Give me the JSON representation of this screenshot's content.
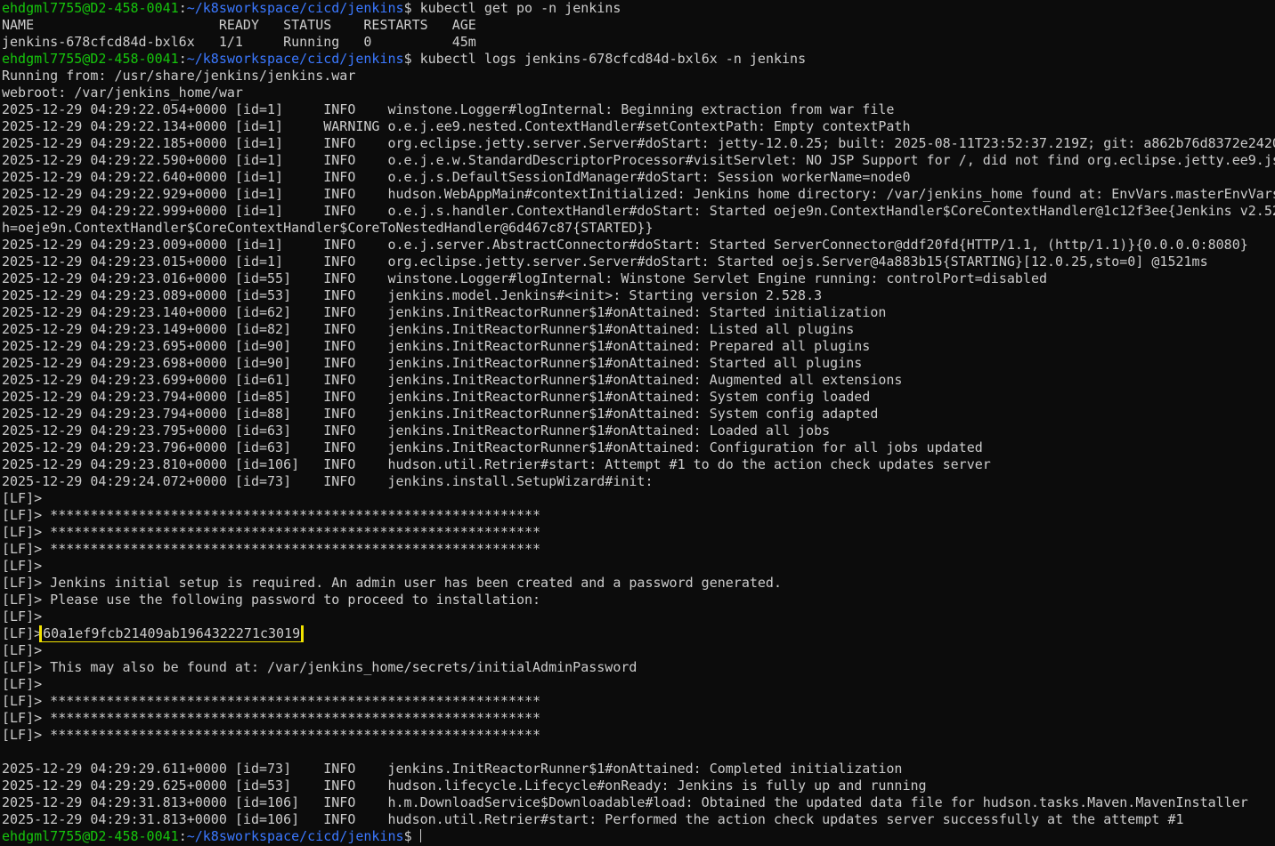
{
  "prompt": {
    "user_host": "ehdgml7755@D2-458-0041",
    "sep": ":",
    "path": "~/k8sworkspace/cicd/jenkins",
    "symbol": "$ "
  },
  "commands": {
    "get_pods": "kubectl get po -n jenkins",
    "logs": "kubectl logs jenkins-678cfcd84d-bxl6x -n jenkins"
  },
  "pods_table": {
    "header": "NAME                       READY   STATUS    RESTARTS   AGE",
    "row": "jenkins-678cfcd84d-bxl6x   1/1     Running   0          45m"
  },
  "log_lines": [
    "Running from: /usr/share/jenkins/jenkins.war",
    "webroot: /var/jenkins_home/war",
    "2025-12-29 04:29:22.054+0000 [id=1]     INFO    winstone.Logger#logInternal: Beginning extraction from war file",
    "2025-12-29 04:29:22.134+0000 [id=1]     WARNING o.e.j.ee9.nested.ContextHandler#setContextPath: Empty contextPath",
    "2025-12-29 04:29:22.185+0000 [id=1]     INFO    org.eclipse.jetty.server.Server#doStart: jetty-12.0.25; built: 2025-08-11T23:52:37.219Z; git: a862b76d8372e2420",
    "2025-12-29 04:29:22.590+0000 [id=1]     INFO    o.e.j.e.w.StandardDescriptorProcessor#visitServlet: NO JSP Support for /, did not find org.eclipse.jetty.ee9.js",
    "2025-12-29 04:29:22.640+0000 [id=1]     INFO    o.e.j.s.DefaultSessionIdManager#doStart: Session workerName=node0",
    "2025-12-29 04:29:22.929+0000 [id=1]     INFO    hudson.WebAppMain#contextInitialized: Jenkins home directory: /var/jenkins_home found at: EnvVars.masterEnvVars",
    "2025-12-29 04:29:22.999+0000 [id=1]     INFO    o.e.j.s.handler.ContextHandler#doStart: Started oeje9n.ContextHandler$CoreContextHandler@1c12f3ee{Jenkins v2.52",
    "h=oeje9n.ContextHandler$CoreContextHandler$CoreToNestedHandler@6d467c87{STARTED}}",
    "2025-12-29 04:29:23.009+0000 [id=1]     INFO    o.e.j.server.AbstractConnector#doStart: Started ServerConnector@ddf20fd{HTTP/1.1, (http/1.1)}{0.0.0.0:8080}",
    "2025-12-29 04:29:23.015+0000 [id=1]     INFO    org.eclipse.jetty.server.Server#doStart: Started oejs.Server@4a883b15{STARTING}[12.0.25,sto=0] @1521ms",
    "2025-12-29 04:29:23.016+0000 [id=55]    INFO    winstone.Logger#logInternal: Winstone Servlet Engine running: controlPort=disabled",
    "2025-12-29 04:29:23.089+0000 [id=53]    INFO    jenkins.model.Jenkins#<init>: Starting version 2.528.3",
    "2025-12-29 04:29:23.140+0000 [id=62]    INFO    jenkins.InitReactorRunner$1#onAttained: Started initialization",
    "2025-12-29 04:29:23.149+0000 [id=82]    INFO    jenkins.InitReactorRunner$1#onAttained: Listed all plugins",
    "2025-12-29 04:29:23.695+0000 [id=90]    INFO    jenkins.InitReactorRunner$1#onAttained: Prepared all plugins",
    "2025-12-29 04:29:23.698+0000 [id=90]    INFO    jenkins.InitReactorRunner$1#onAttained: Started all plugins",
    "2025-12-29 04:29:23.699+0000 [id=61]    INFO    jenkins.InitReactorRunner$1#onAttained: Augmented all extensions",
    "2025-12-29 04:29:23.794+0000 [id=85]    INFO    jenkins.InitReactorRunner$1#onAttained: System config loaded",
    "2025-12-29 04:29:23.794+0000 [id=88]    INFO    jenkins.InitReactorRunner$1#onAttained: System config adapted",
    "2025-12-29 04:29:23.795+0000 [id=63]    INFO    jenkins.InitReactorRunner$1#onAttained: Loaded all jobs",
    "2025-12-29 04:29:23.796+0000 [id=63]    INFO    jenkins.InitReactorRunner$1#onAttained: Configuration for all jobs updated",
    "2025-12-29 04:29:23.810+0000 [id=106]   INFO    hudson.util.Retrier#start: Attempt #1 to do the action check updates server",
    "2025-12-29 04:29:24.072+0000 [id=73]    INFO    jenkins.install.SetupWizard#init:",
    "[LF]>",
    "[LF]> *************************************************************",
    "[LF]> *************************************************************",
    "[LF]> *************************************************************",
    "[LF]>",
    "[LF]> Jenkins initial setup is required. An admin user has been created and a password generated.",
    "[LF]> Please use the following password to proceed to installation:",
    "[LF]>"
  ],
  "password_line": {
    "prefix": "[LF]>",
    "password": "60a1ef9fcb21409ab1964322271c3019"
  },
  "log_lines_2": [
    "[LF]>",
    "[LF]> This may also be found at: /var/jenkins_home/secrets/initialAdminPassword",
    "[LF]>",
    "[LF]> *************************************************************",
    "[LF]> *************************************************************",
    "[LF]> *************************************************************",
    "",
    "2025-12-29 04:29:29.611+0000 [id=73]    INFO    jenkins.InitReactorRunner$1#onAttained: Completed initialization",
    "2025-12-29 04:29:29.625+0000 [id=53]    INFO    hudson.lifecycle.Lifecycle#onReady: Jenkins is fully up and running",
    "2025-12-29 04:29:31.813+0000 [id=106]   INFO    h.m.DownloadService$Downloadable#load: Obtained the updated data file for hudson.tasks.Maven.MavenInstaller",
    "2025-12-29 04:29:31.813+0000 [id=106]   INFO    hudson.util.Retrier#start: Performed the action check updates server successfully at the attempt #1"
  ],
  "colors": {
    "background": "#0c0c0c",
    "text": "#cccccc",
    "prompt_user": "#16c60c",
    "prompt_path": "#3b78ff",
    "highlight_box": "#f2e300"
  }
}
